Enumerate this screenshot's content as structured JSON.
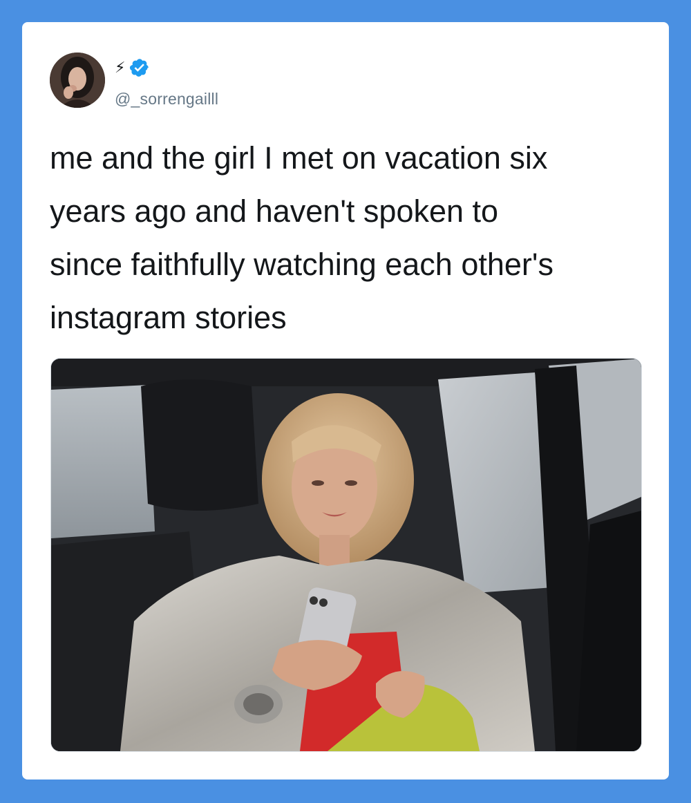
{
  "tweet": {
    "author": {
      "display_name": "⚡",
      "handle": "@_sorrengailll",
      "verified": true,
      "avatar_icon": "user-avatar"
    },
    "text": "me and the girl I met on vacation six\nyears ago and haven't spoken to\nsince faithfully watching each other's\ninstagram stories",
    "media": {
      "type": "image",
      "icon": "photo"
    }
  },
  "colors": {
    "background": "#4a90e2",
    "card": "#ffffff",
    "verified": "#1d9bf0",
    "handle": "#657786",
    "text": "#14171a"
  }
}
